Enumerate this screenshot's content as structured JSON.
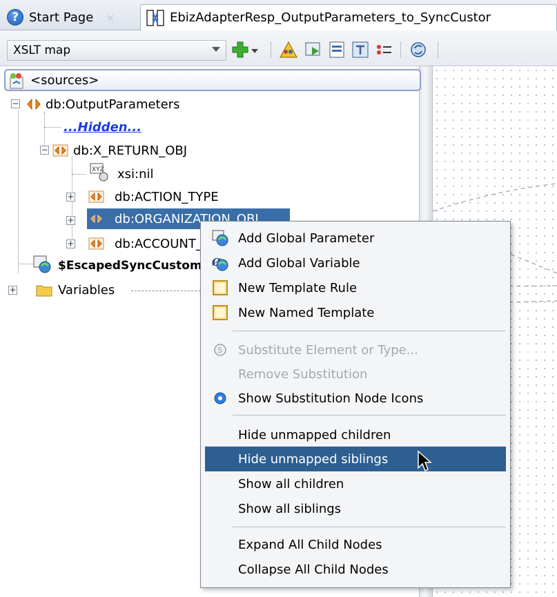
{
  "tabs": [
    {
      "label": "Start Page",
      "close": "×"
    },
    {
      "label": "EbizAdapterResp_OutputParameters_to_SyncCustor"
    }
  ],
  "toolbar": {
    "map_select_value": "XSLT map",
    "icons": [
      "add-icon",
      "warning-people-icon",
      "test-icon",
      "report-icon",
      "template-icon",
      "list-icon",
      "refresh-icon"
    ]
  },
  "tree": {
    "root": "<sources>",
    "nodes": [
      {
        "label": "db:OutputParameters"
      },
      {
        "label": "...Hidden..."
      },
      {
        "label": "db:X_RETURN_OBJ"
      },
      {
        "label": "xsi:nil"
      },
      {
        "label": "db:ACTION_TYPE"
      },
      {
        "label": "db:ORGANIZATION_OBJ"
      },
      {
        "label": "db:ACCOUNT_OBJ"
      },
      {
        "label": "$EscapedSyncCustomer"
      },
      {
        "label": "Variables"
      }
    ]
  },
  "context_menu": {
    "items": [
      {
        "label": "Add Global Parameter",
        "icon": "global-parameter-icon",
        "enabled": true
      },
      {
        "label": "Add Global Variable",
        "icon": "global-variable-icon",
        "enabled": true
      },
      {
        "label": "New Template Rule",
        "icon": "template-rule-icon",
        "enabled": true
      },
      {
        "label": "New Named Template",
        "icon": "named-template-icon",
        "enabled": true
      },
      {
        "label": "Substitute Element or Type...",
        "icon": "substitute-icon",
        "enabled": false
      },
      {
        "label": "Remove Substitution",
        "enabled": false
      },
      {
        "label": "Show Substitution Node Icons",
        "icon": "radio-selected-icon",
        "enabled": true,
        "selected": true
      },
      {
        "label": "Hide unmapped children",
        "enabled": true
      },
      {
        "label": "Hide unmapped siblings",
        "enabled": true,
        "highlighted": true
      },
      {
        "label": "Show all children",
        "enabled": true
      },
      {
        "label": "Show all siblings",
        "enabled": true
      },
      {
        "label": "Expand All Child Nodes",
        "enabled": true
      },
      {
        "label": "Collapse All Child Nodes",
        "enabled": true
      }
    ]
  },
  "colors": {
    "menu_highlight": "#2e5f91",
    "tree_selection": "#3a6ea8",
    "link": "#1b3fdc",
    "disabled_text": "#a3a8b1"
  }
}
